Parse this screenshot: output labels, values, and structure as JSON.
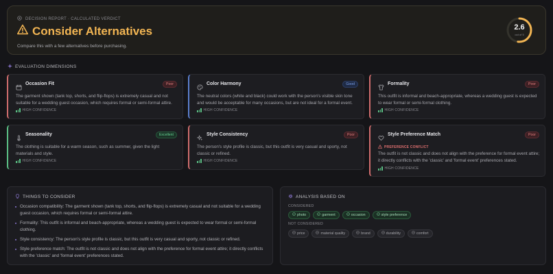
{
  "verdict": {
    "eyebrow": "DECISION REPORT · CALCULATED VERDICT",
    "title": "Consider Alternatives",
    "subtitle": "Compare this with a few alternatives before purchasing.",
    "score": "2.6",
    "score_out_of": "out of 5",
    "score_fraction": 0.52,
    "accent_color": "#f2b553"
  },
  "dimensions_heading": "EVALUATION DIMENSIONS",
  "dimensions": [
    {
      "title": "Occasion Fit",
      "rating": "Poor",
      "icon": "calendar-icon",
      "text": "The garment shown (tank top, shorts, and flip-flops) is extremely casual and not suitable for a wedding guest occasion, which requires formal or semi-formal attire.",
      "confidence": "HIGH CONFIDENCE"
    },
    {
      "title": "Color Harmony",
      "rating": "Good",
      "icon": "palette-icon",
      "text": "The neutral colors (white and black) could work with the person's visible skin tone and would be acceptable for many occasions, but are not ideal for a formal event.",
      "confidence": "HIGH CONFIDENCE"
    },
    {
      "title": "Formality",
      "rating": "Poor",
      "icon": "shirt-icon",
      "text": "This outfit is informal and beach-appropriate, whereas a wedding guest is expected to wear formal or semi-formal clothing.",
      "confidence": "HIGH CONFIDENCE"
    },
    {
      "title": "Seasonality",
      "rating": "Excellent",
      "icon": "thermometer-icon",
      "text": "The clothing is suitable for a warm season, such as summer, given the light materials and style.",
      "confidence": "HIGH CONFIDENCE"
    },
    {
      "title": "Style Consistency",
      "rating": "Poor",
      "icon": "sparkle-icon",
      "text": "The person's style profile is classic, but this outfit is very casual and sporty, not classic or refined.",
      "confidence": "HIGH CONFIDENCE"
    },
    {
      "title": "Style Preference Match",
      "rating": "Poor",
      "icon": "heart-icon",
      "conflict": "PREFERENCE CONFLICT",
      "text": "The outfit is not classic and does not align with the preference for formal event attire; it directly conflicts with the 'classic' and 'formal event' preferences stated.",
      "confidence": "HIGH CONFIDENCE"
    }
  ],
  "considerations": {
    "heading": "THINGS TO CONSIDER",
    "items": [
      "Occasion compatibility: The garment shown (tank top, shorts, and flip-flops) is extremely casual and not suitable for a wedding guest occasion, which requires formal or semi-formal attire.",
      "Formality: This outfit is informal and beach-appropriate, whereas a wedding guest is expected to wear formal or semi-formal clothing.",
      "Style consistency: The person's style profile is classic, but this outfit is very casual and sporty, not classic or refined.",
      "Style preference match: The outfit is not classic and does not align with the preference for formal event attire; it directly conflicts with the 'classic' and 'formal event' preferences stated."
    ]
  },
  "analysis": {
    "heading": "ANALYSIS BASED ON",
    "considered_label": "CONSIDERED",
    "considered": [
      "photo",
      "garment",
      "occasion",
      "style preference"
    ],
    "not_considered_label": "NOT CONSIDERED",
    "not_considered": [
      "price",
      "material quality",
      "brand",
      "durability",
      "comfort"
    ]
  },
  "colors": {
    "poor": "#d06d6d",
    "good": "#5b7fce",
    "excellent": "#5bbf84"
  }
}
